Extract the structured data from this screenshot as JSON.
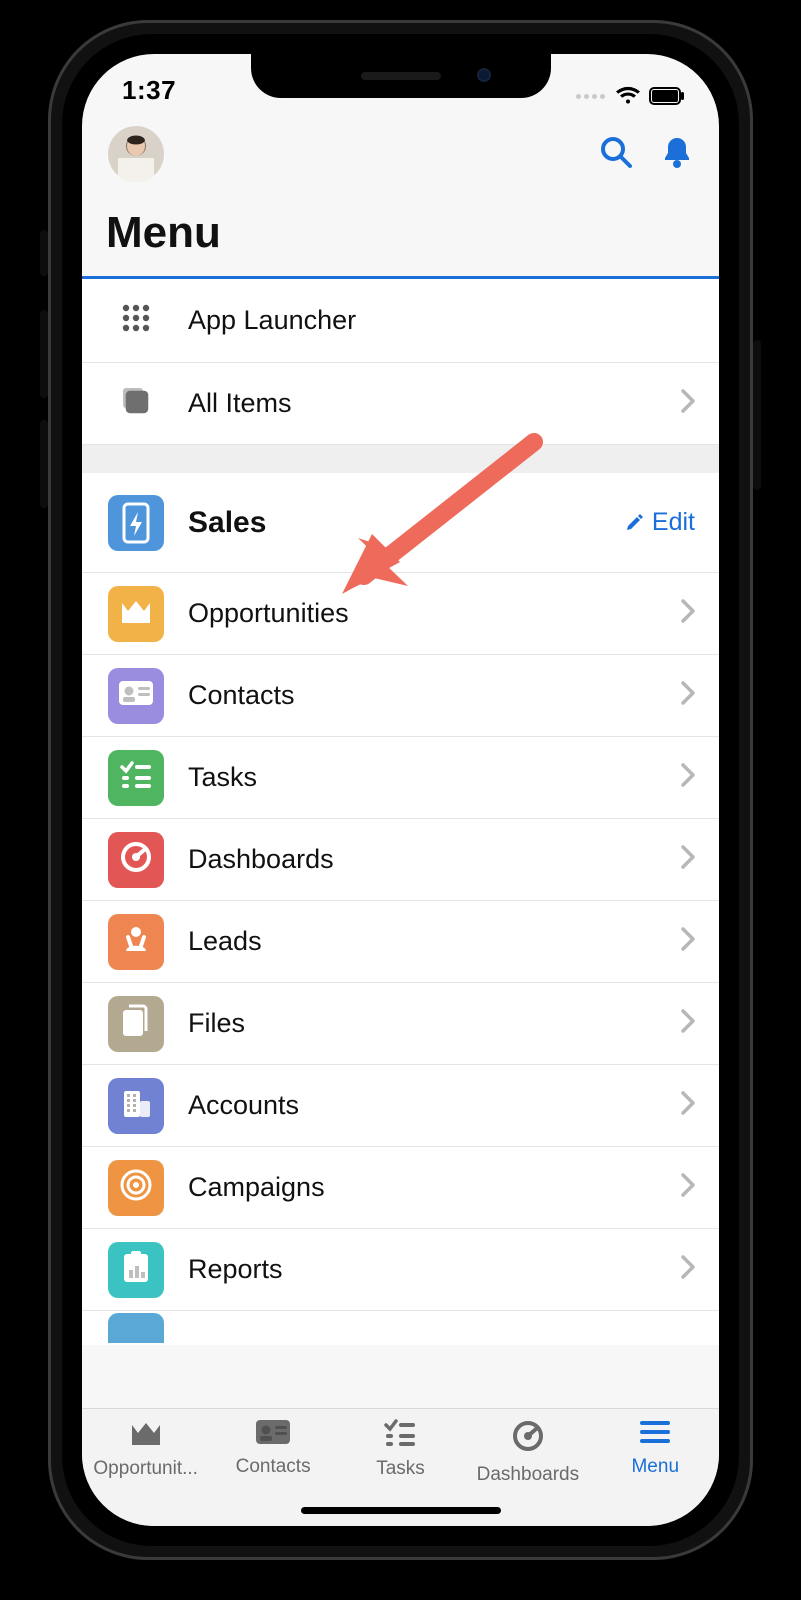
{
  "status": {
    "time": "1:37"
  },
  "header": {
    "title": "Menu"
  },
  "top_list": [
    {
      "key": "app-launcher",
      "label": "App Launcher",
      "chevron": false,
      "icon": "grid"
    },
    {
      "key": "all-items",
      "label": "All Items",
      "chevron": true,
      "icon": "stack"
    }
  ],
  "section": {
    "key": "sales",
    "label": "Sales",
    "edit_label": "Edit",
    "icon": "phone-bolt",
    "color": "#4e95db"
  },
  "items": [
    {
      "key": "opportunities",
      "label": "Opportunities",
      "icon": "crown",
      "color": "#f1b248"
    },
    {
      "key": "contacts",
      "label": "Contacts",
      "icon": "id-card",
      "color": "#9a8de0"
    },
    {
      "key": "tasks",
      "label": "Tasks",
      "icon": "tasks",
      "color": "#4fb561"
    },
    {
      "key": "dashboards",
      "label": "Dashboards",
      "icon": "gauge",
      "color": "#e35656"
    },
    {
      "key": "leads",
      "label": "Leads",
      "icon": "star-person",
      "color": "#ef8550"
    },
    {
      "key": "files",
      "label": "Files",
      "icon": "files",
      "color": "#b3a990"
    },
    {
      "key": "accounts",
      "label": "Accounts",
      "icon": "building",
      "color": "#7182d2"
    },
    {
      "key": "campaigns",
      "label": "Campaigns",
      "icon": "target",
      "color": "#ee9442"
    },
    {
      "key": "reports",
      "label": "Reports",
      "icon": "report",
      "color": "#3bc3c1"
    }
  ],
  "tabs": [
    {
      "key": "opportunities",
      "label": "Opportunit...",
      "icon": "crown",
      "active": false
    },
    {
      "key": "contacts",
      "label": "Contacts",
      "icon": "id-card",
      "active": false
    },
    {
      "key": "tasks",
      "label": "Tasks",
      "icon": "tasks",
      "active": false
    },
    {
      "key": "dashboards",
      "label": "Dashboards",
      "icon": "gauge",
      "active": false
    },
    {
      "key": "menu",
      "label": "Menu",
      "icon": "menu",
      "active": true
    }
  ],
  "colors": {
    "accent": "#1b6fd8",
    "tab_inactive": "#6b6b6b"
  }
}
